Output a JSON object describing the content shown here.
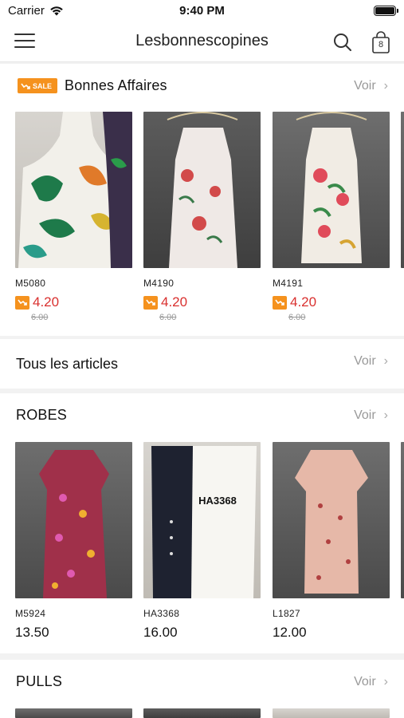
{
  "status_bar": {
    "carrier": "Carrier",
    "time": "9:40 PM"
  },
  "nav": {
    "title": "Lesbonnescopines",
    "cart_count": "8"
  },
  "see_more": "Voir",
  "sale_section": {
    "badge": "SALE",
    "title": "Bonnes Affaires",
    "products": [
      {
        "ref": "M5080",
        "price": "4.20",
        "old_price": "6.00"
      },
      {
        "ref": "M4190",
        "price": "4.20",
        "old_price": "6.00"
      },
      {
        "ref": "M4191",
        "price": "4.20",
        "old_price": "6.00"
      }
    ]
  },
  "all_items": {
    "label": "Tous les articles"
  },
  "robes_section": {
    "title": "ROBES",
    "products": [
      {
        "ref": "M5924",
        "price": "13.50"
      },
      {
        "ref": "HA3368",
        "price": "16.00",
        "photo_tag": "HA3368"
      },
      {
        "ref": "L1827",
        "price": "12.00"
      }
    ]
  },
  "pulls_section": {
    "title": "PULLS"
  },
  "colors": {
    "accent": "#f5921e",
    "sale_price": "#d9302f",
    "muted": "#999999"
  }
}
